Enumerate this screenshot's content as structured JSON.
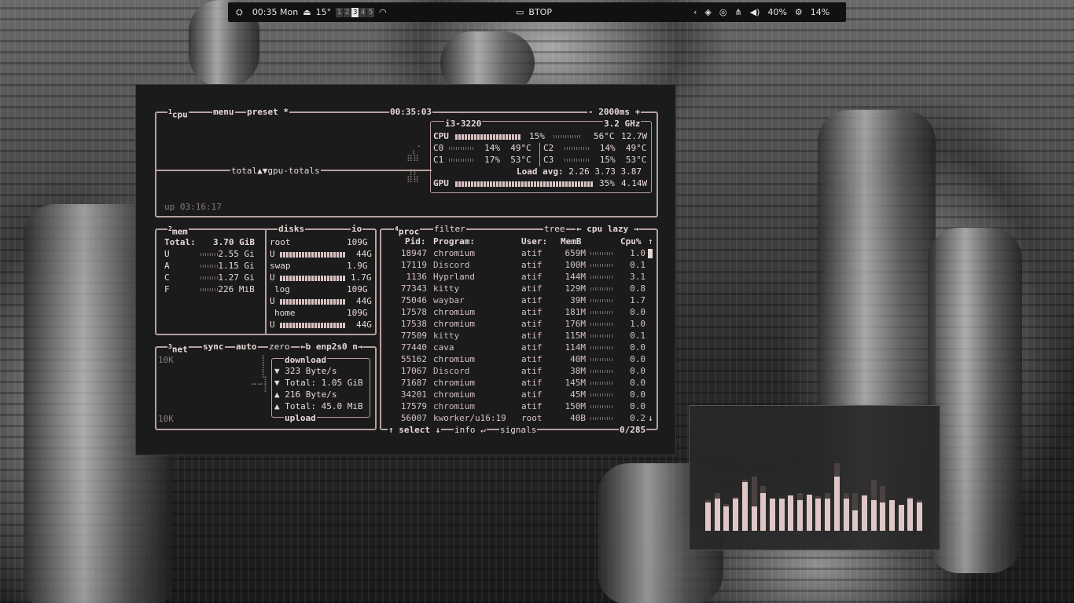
{
  "topbar": {
    "time": "00:35 Mon",
    "weather": "15°",
    "workspaces": [
      "1",
      "2",
      "3",
      "4",
      "5"
    ],
    "active_workspace": "3",
    "window_title": "BTOP",
    "volume": "40%",
    "cpu": "14%"
  },
  "btop": {
    "cpu_box": {
      "index": "1",
      "title": "cpu",
      "menu": "menu",
      "preset": "preset *",
      "clock": "00:35:03",
      "interval": "- 2000ms +",
      "graph_label": "total",
      "graph_arrows": "▲▼",
      "graph_mode": "gpu-totals",
      "uptime": "up 03:16:17",
      "model": "i3-3220",
      "freq": "3.2 GHz",
      "cpu_label": "CPU",
      "cpu_pct": "15%",
      "cpu_temp": "56°C",
      "cpu_power": "12.7W",
      "cores": [
        {
          "name": "C0",
          "pct": "14%",
          "temp": "49°C"
        },
        {
          "name": "C2",
          "pct": "14%",
          "temp": "49°C"
        },
        {
          "name": "C1",
          "pct": "17%",
          "temp": "53°C"
        },
        {
          "name": "C3",
          "pct": "15%",
          "temp": "53°C"
        }
      ],
      "load_avg_label": "Load avg:",
      "load_avg": "2.26 3.73 3.87",
      "gpu_label": "GPU",
      "gpu_pct": "35%",
      "gpu_power": "4.14W"
    },
    "mem_box": {
      "index": "2",
      "title": "mem",
      "total_label": "Total:",
      "total": "3.70 GiB",
      "rows": [
        {
          "k": "U",
          "v": "2.55 Gi"
        },
        {
          "k": "A",
          "v": "1.15 Gi"
        },
        {
          "k": "C",
          "v": "1.27 Gi"
        },
        {
          "k": "F",
          "v": "226 MiB"
        }
      ]
    },
    "disks_box": {
      "title": "disks",
      "io": "io",
      "disks": [
        {
          "name": "root",
          "size": "109G",
          "used": "44G"
        },
        {
          "name": "swap",
          "size": "1.9G",
          "used": "1.7G"
        },
        {
          "name": "log",
          "size": "109G",
          "used": "44G"
        },
        {
          "name": "home",
          "size": "109G",
          "used": "44G"
        }
      ],
      "used_prefix": "U"
    },
    "net_box": {
      "index": "3",
      "title": "net",
      "sync": "sync",
      "auto": "auto",
      "zero": "zero",
      "iface": "←b enp2s0 n→",
      "scale_top": "10K",
      "scale_bottom": "10K",
      "download_label": "download",
      "download_rate": "▼ 323 Byte/s",
      "download_total": "▼ Total: 1.05 GiB",
      "upload_rate": "▲ 216 Byte/s",
      "upload_total": "▲ Total: 45.0 MiB",
      "upload_label": "upload"
    },
    "proc_box": {
      "index": "4",
      "title": "proc",
      "filter": "filter",
      "tree": "tree",
      "sort": "← cpu lazy →",
      "headers": {
        "pid": "Pid:",
        "program": "Program:",
        "user": "User:",
        "mem": "MemB",
        "cpu": "Cpu%"
      },
      "rows": [
        {
          "pid": "18947",
          "program": "chromium",
          "user": "atif",
          "mem": "659M",
          "cpu": "1.0"
        },
        {
          "pid": "17119",
          "program": "Discord",
          "user": "atif",
          "mem": "100M",
          "cpu": "0.1"
        },
        {
          "pid": "1136",
          "program": "Hyprland",
          "user": "atif",
          "mem": "144M",
          "cpu": "3.1"
        },
        {
          "pid": "77343",
          "program": "kitty",
          "user": "atif",
          "mem": "129M",
          "cpu": "0.8"
        },
        {
          "pid": "75046",
          "program": "waybar",
          "user": "atif",
          "mem": "39M",
          "cpu": "1.7"
        },
        {
          "pid": "17578",
          "program": "chromium",
          "user": "atif",
          "mem": "181M",
          "cpu": "0.0"
        },
        {
          "pid": "17538",
          "program": "chromium",
          "user": "atif",
          "mem": "176M",
          "cpu": "1.0"
        },
        {
          "pid": "77509",
          "program": "kitty",
          "user": "atif",
          "mem": "115M",
          "cpu": "0.1"
        },
        {
          "pid": "77440",
          "program": "cava",
          "user": "atif",
          "mem": "114M",
          "cpu": "0.0"
        },
        {
          "pid": "55162",
          "program": "chromium",
          "user": "atif",
          "mem": "40M",
          "cpu": "0.0"
        },
        {
          "pid": "17067",
          "program": "Discord",
          "user": "atif",
          "mem": "38M",
          "cpu": "0.0"
        },
        {
          "pid": "71687",
          "program": "chromium",
          "user": "atif",
          "mem": "145M",
          "cpu": "0.0"
        },
        {
          "pid": "34201",
          "program": "chromium",
          "user": "atif",
          "mem": "45M",
          "cpu": "0.0"
        },
        {
          "pid": "17579",
          "program": "chromium",
          "user": "atif",
          "mem": "150M",
          "cpu": "0.0"
        },
        {
          "pid": "56007",
          "program": "kworker/u16:19",
          "user": "root",
          "mem": "40B",
          "cpu": "0.2"
        }
      ],
      "select": "↑ select ↓",
      "info": "info ↵",
      "signals": "signals",
      "count": "0/285"
    }
  },
  "visualizer": {
    "levels": [
      0.42,
      0.48,
      0.36,
      0.48,
      0.72,
      0.36,
      0.56,
      0.48,
      0.48,
      0.52,
      0.46,
      0.54,
      0.48,
      0.48,
      0.8,
      0.48,
      0.3,
      0.52,
      0.46,
      0.42,
      0.46,
      0.38,
      0.48,
      0.42
    ],
    "peaks": [
      0.46,
      0.56,
      0.4,
      0.5,
      0.76,
      0.8,
      0.66,
      0.48,
      0.48,
      0.52,
      0.56,
      0.54,
      0.52,
      0.56,
      1.0,
      0.56,
      0.56,
      0.52,
      0.76,
      0.66,
      0.46,
      0.38,
      0.5,
      0.46
    ]
  },
  "colors": {
    "accent": "#b9a0a0",
    "text": "#e8d8d8"
  }
}
